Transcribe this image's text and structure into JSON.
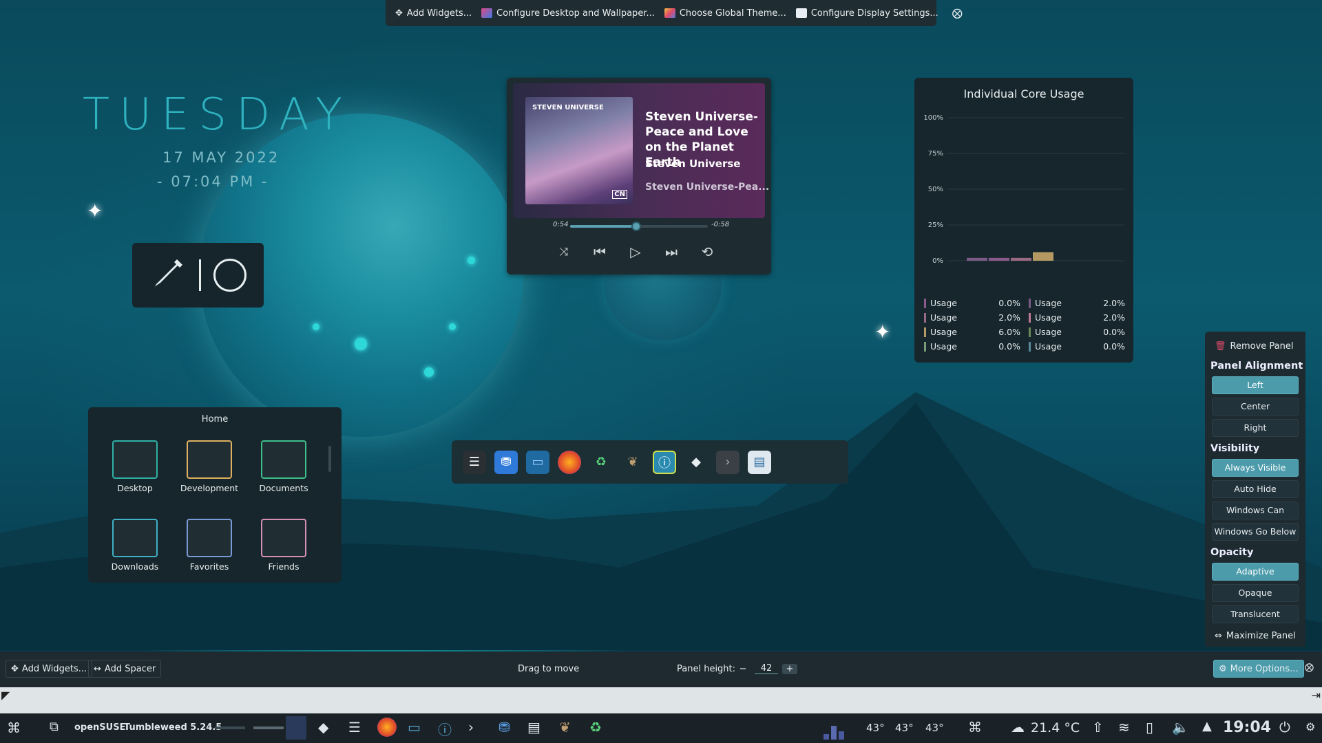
{
  "top_toolbar": {
    "items": [
      {
        "label": "Add Widgets...",
        "icon": "plus-icon"
      },
      {
        "label": "Configure Desktop and Wallpaper...",
        "icon": "desktop-icon"
      },
      {
        "label": "Choose Global Theme...",
        "icon": "theme-icon"
      },
      {
        "label": "Configure Display Settings...",
        "icon": "display-icon"
      }
    ],
    "close_icon": "close-icon"
  },
  "clock_widget": {
    "day": "TUESDAY",
    "date": "17 MAY 2022",
    "time": "- 07:04 PM -"
  },
  "media_player": {
    "title": "Steven Universe-Peace and Love on the Planet Earth",
    "artist": "Steven Universe",
    "album": "Steven Universe-Pea...",
    "elapsed": "0:54",
    "remaining": "-0:58",
    "progress": 0.48,
    "album_art_text": "STEVEN UNIVERSE",
    "album_art_badge": "CN"
  },
  "cpu_widget": {
    "title": "Individual Core Usage",
    "legend": [
      {
        "label": "Usage",
        "value": "0.0%",
        "color": "#8a5a8c"
      },
      {
        "label": "Usage",
        "value": "2.0%",
        "color": "#7a5a86"
      },
      {
        "label": "Usage",
        "value": "2.0%",
        "color": "#9a6a84"
      },
      {
        "label": "Usage",
        "value": "2.0%",
        "color": "#c07a96"
      },
      {
        "label": "Usage",
        "value": "6.0%",
        "color": "#b49a62"
      },
      {
        "label": "Usage",
        "value": "0.0%",
        "color": "#6a8a5a"
      },
      {
        "label": "Usage",
        "value": "0.0%",
        "color": "#7a9a7a"
      },
      {
        "label": "Usage",
        "value": "0.0%",
        "color": "#5a8a9a"
      }
    ]
  },
  "chart_data": {
    "type": "bar",
    "title": "Individual Core Usage",
    "yticks": [
      "100%",
      "75%",
      "50%",
      "25%",
      "0%"
    ],
    "ylim": [
      0,
      100
    ],
    "series": [
      {
        "values": [
          2.0,
          2.0,
          2.0,
          6.0
        ],
        "colors": [
          "#7a5a86",
          "#8a5a8c",
          "#9a6a84",
          "#b49a62"
        ]
      }
    ],
    "grid": true
  },
  "home_widget": {
    "title": "Home",
    "folders": [
      {
        "label": "Desktop",
        "color": "#2fb2a6"
      },
      {
        "label": "Development",
        "color": "#e0b060"
      },
      {
        "label": "Documents",
        "color": "#3fbf8a"
      },
      {
        "label": "Downloads",
        "color": "#3fb0c6"
      },
      {
        "label": "Favorites",
        "color": "#7a9ad6"
      },
      {
        "label": "Friends",
        "color": "#d690b6"
      }
    ]
  },
  "dock": {
    "apps": [
      "settings-icon",
      "store-icon",
      "files-icon",
      "firefox-icon",
      "recycle-icon",
      "gimp-icon",
      "info-icon",
      "inkscape-icon",
      "terminal-icon",
      "monitor-icon"
    ]
  },
  "panel_settings": {
    "remove_panel": "Remove Panel",
    "alignment_heading": "Panel Alignment",
    "alignment_options": [
      "Left",
      "Center",
      "Right"
    ],
    "alignment_selected": "Left",
    "visibility_heading": "Visibility",
    "visibility_options": [
      "Always Visible",
      "Auto Hide",
      "Windows Can Cover",
      "Windows Go Below"
    ],
    "visibility_selected": "Always Visible",
    "opacity_heading": "Opacity",
    "opacity_options": [
      "Adaptive",
      "Opaque",
      "Translucent"
    ],
    "opacity_selected": "Adaptive",
    "maximize": "Maximize Panel"
  },
  "panel_edit_bar": {
    "add_widgets": "Add Widgets...",
    "add_spacer": "Add Spacer",
    "drag_to_move": "Drag to move",
    "panel_height_label": "Panel height:",
    "panel_height_value": "42",
    "more_options": "More Options..."
  },
  "taskbar": {
    "os_name": "openSUSE",
    "os_version": "Tumbleweed 5.24.5",
    "temps": [
      "43°",
      "43°",
      "43°"
    ],
    "weather": "21.4 °C",
    "clock": "19:04"
  }
}
